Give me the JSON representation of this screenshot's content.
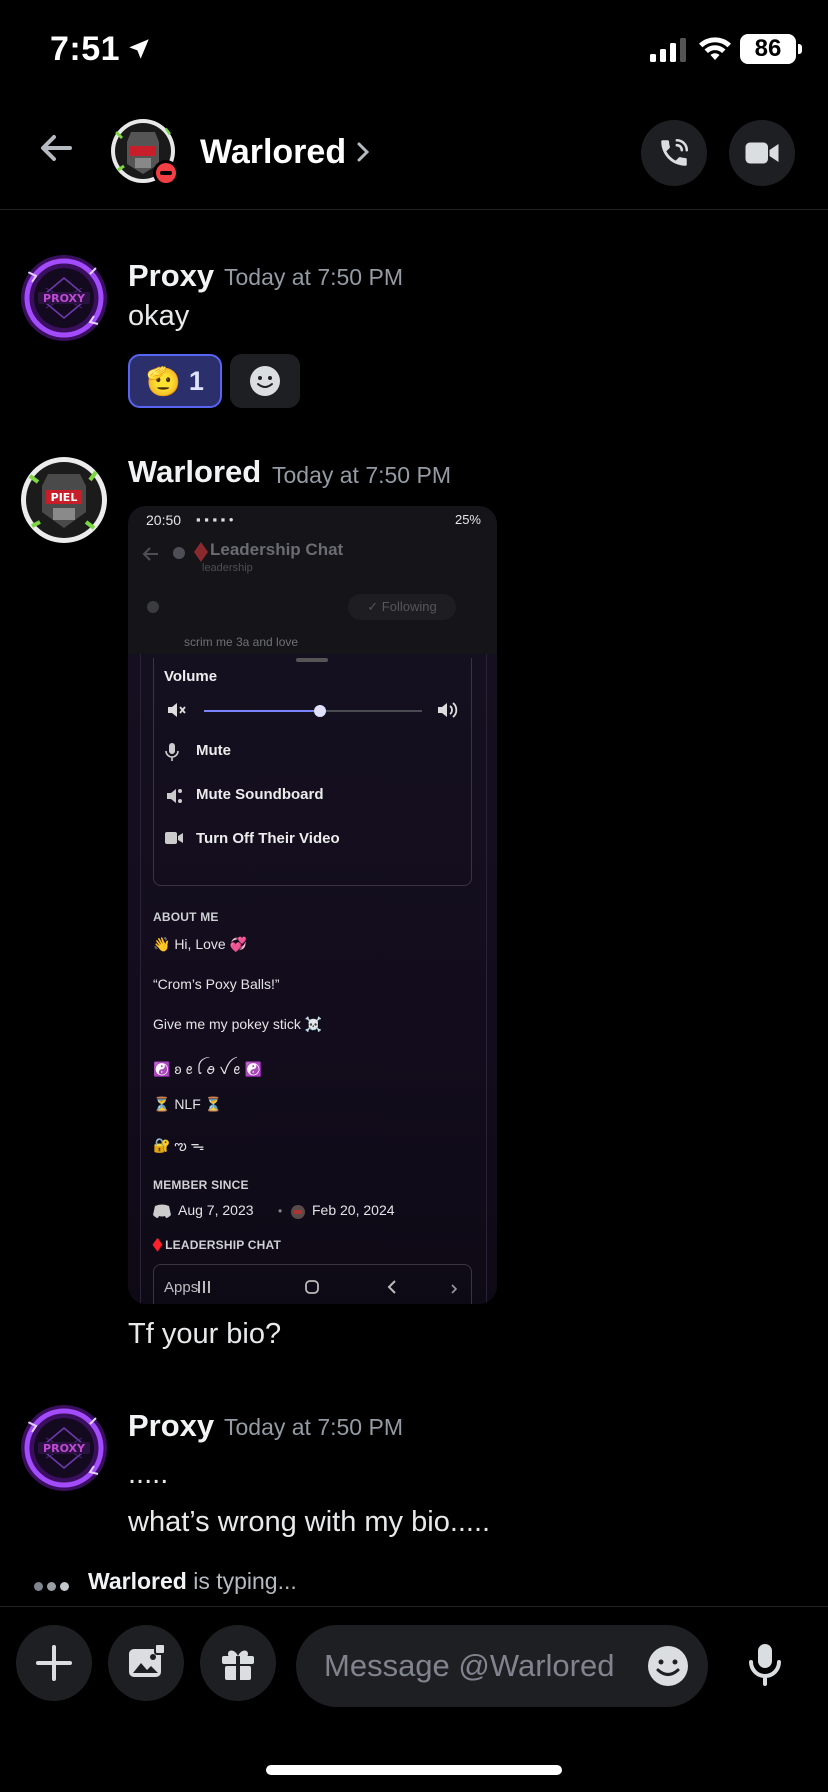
{
  "status_bar": {
    "time": "7:51",
    "battery": "86"
  },
  "header": {
    "title": "Warlored"
  },
  "messages": [
    {
      "author": "Proxy",
      "timestamp": "Today at 7:50 PM",
      "lines": [
        "okay"
      ],
      "reaction": {
        "emoji": "🫡",
        "count": "1"
      }
    },
    {
      "author": "Warlored",
      "timestamp": "Today at 7:50 PM",
      "lines": [
        "Tf your bio?"
      ]
    },
    {
      "author": "Proxy",
      "timestamp": "Today at 7:50 PM",
      "lines": [
        ".....",
        "what’s wrong with my bio....."
      ]
    }
  ],
  "attachment": {
    "status_time": "20:50",
    "status_right": "25%",
    "chat_title": "Leadership Chat",
    "chat_sub": "leadership",
    "following": "✓ Following",
    "faded_text": "scrim me 3a and love",
    "volume_label": "Volume",
    "volume_level": 0.53,
    "options": [
      "Mute",
      "Mute Soundboard",
      "Turn Off Their Video"
    ],
    "about_title": "ABOUT ME",
    "about_lines": [
      "👋 Hi, Love 💞",
      "“Crom’s Poxy Balls!”",
      "Give me my pokey stick ☠️",
      "☯️ ʚ ꫀ ꪶ ꪮ ꪜ ꫀ ☯️",
      "⏳ NLF ⏳",
      "🔐 ఌ︎ ᯓ"
    ],
    "member_title": "MEMBER SINCE",
    "member_discord": "Aug 7, 2023",
    "member_server": "Feb 20, 2024",
    "leadership_label": "♦️LEADERSHIP CHAT",
    "nav_apps": "Apps"
  },
  "typing": {
    "user": "Warlored",
    "suffix": " is typing..."
  },
  "composer": {
    "placeholder": "Message @Warlored"
  },
  "colors": {
    "accent": "#5865f2",
    "background": "#000000",
    "surface": "#1e1f22",
    "dnd": "#f23f43"
  }
}
